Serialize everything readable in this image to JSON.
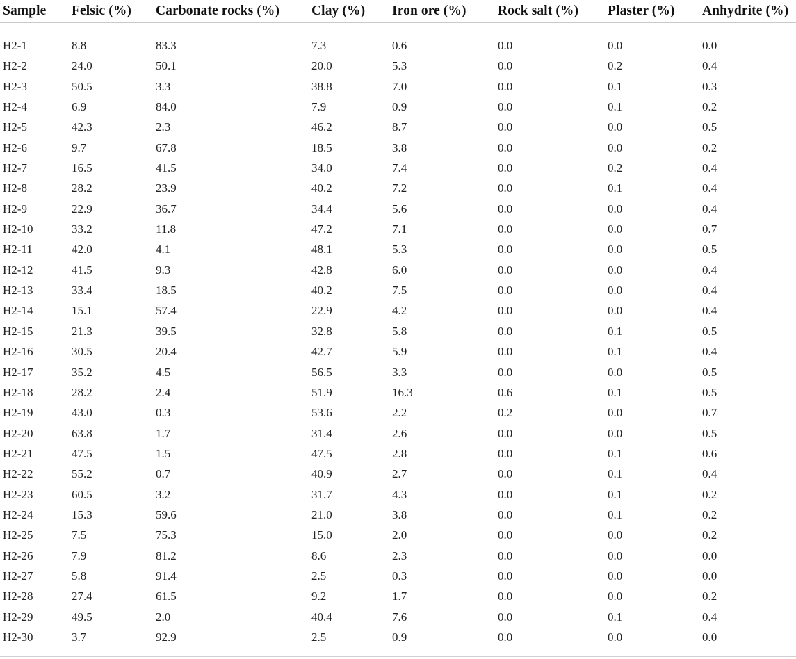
{
  "table": {
    "caption": "",
    "columns": [
      {
        "key": "sample",
        "label": "Sample"
      },
      {
        "key": "felsic",
        "label": "Felsic (%)"
      },
      {
        "key": "carbonate",
        "label": "Carbonate rocks (%)"
      },
      {
        "key": "clay",
        "label": "Clay (%)"
      },
      {
        "key": "iron_ore",
        "label": "Iron ore (%)"
      },
      {
        "key": "rock_salt",
        "label": "Rock salt (%)"
      },
      {
        "key": "plaster",
        "label": "Plaster (%)"
      },
      {
        "key": "anhydrite",
        "label": "Anhydrite (%)"
      }
    ],
    "rows": [
      {
        "sample": "H2-1",
        "felsic": "8.8",
        "carbonate": "83.3",
        "clay": "7.3",
        "iron_ore": "0.6",
        "rock_salt": "0.0",
        "plaster": "0.0",
        "anhydrite": "0.0"
      },
      {
        "sample": "H2-2",
        "felsic": "24.0",
        "carbonate": "50.1",
        "clay": "20.0",
        "iron_ore": "5.3",
        "rock_salt": "0.0",
        "plaster": "0.2",
        "anhydrite": "0.4"
      },
      {
        "sample": "H2-3",
        "felsic": "50.5",
        "carbonate": "3.3",
        "clay": "38.8",
        "iron_ore": "7.0",
        "rock_salt": "0.0",
        "plaster": "0.1",
        "anhydrite": "0.3"
      },
      {
        "sample": "H2-4",
        "felsic": "6.9",
        "carbonate": "84.0",
        "clay": "7.9",
        "iron_ore": "0.9",
        "rock_salt": "0.0",
        "plaster": "0.1",
        "anhydrite": "0.2"
      },
      {
        "sample": "H2-5",
        "felsic": "42.3",
        "carbonate": "2.3",
        "clay": "46.2",
        "iron_ore": "8.7",
        "rock_salt": "0.0",
        "plaster": "0.0",
        "anhydrite": "0.5"
      },
      {
        "sample": "H2-6",
        "felsic": "9.7",
        "carbonate": "67.8",
        "clay": "18.5",
        "iron_ore": "3.8",
        "rock_salt": "0.0",
        "plaster": "0.0",
        "anhydrite": "0.2"
      },
      {
        "sample": "H2-7",
        "felsic": "16.5",
        "carbonate": "41.5",
        "clay": "34.0",
        "iron_ore": "7.4",
        "rock_salt": "0.0",
        "plaster": "0.2",
        "anhydrite": "0.4"
      },
      {
        "sample": "H2-8",
        "felsic": "28.2",
        "carbonate": "23.9",
        "clay": "40.2",
        "iron_ore": "7.2",
        "rock_salt": "0.0",
        "plaster": "0.1",
        "anhydrite": "0.4"
      },
      {
        "sample": "H2-9",
        "felsic": "22.9",
        "carbonate": "36.7",
        "clay": "34.4",
        "iron_ore": "5.6",
        "rock_salt": "0.0",
        "plaster": "0.0",
        "anhydrite": "0.4"
      },
      {
        "sample": "H2-10",
        "felsic": "33.2",
        "carbonate": "11.8",
        "clay": "47.2",
        "iron_ore": "7.1",
        "rock_salt": "0.0",
        "plaster": "0.0",
        "anhydrite": "0.7"
      },
      {
        "sample": "H2-11",
        "felsic": "42.0",
        "carbonate": "4.1",
        "clay": "48.1",
        "iron_ore": "5.3",
        "rock_salt": "0.0",
        "plaster": "0.0",
        "anhydrite": "0.5"
      },
      {
        "sample": "H2-12",
        "felsic": "41.5",
        "carbonate": "9.3",
        "clay": "42.8",
        "iron_ore": "6.0",
        "rock_salt": "0.0",
        "plaster": "0.0",
        "anhydrite": "0.4"
      },
      {
        "sample": "H2-13",
        "felsic": "33.4",
        "carbonate": "18.5",
        "clay": "40.2",
        "iron_ore": "7.5",
        "rock_salt": "0.0",
        "plaster": "0.0",
        "anhydrite": "0.4"
      },
      {
        "sample": "H2-14",
        "felsic": "15.1",
        "carbonate": "57.4",
        "clay": "22.9",
        "iron_ore": "4.2",
        "rock_salt": "0.0",
        "plaster": "0.0",
        "anhydrite": "0.4"
      },
      {
        "sample": "H2-15",
        "felsic": "21.3",
        "carbonate": "39.5",
        "clay": "32.8",
        "iron_ore": "5.8",
        "rock_salt": "0.0",
        "plaster": "0.1",
        "anhydrite": "0.5"
      },
      {
        "sample": "H2-16",
        "felsic": "30.5",
        "carbonate": "20.4",
        "clay": "42.7",
        "iron_ore": "5.9",
        "rock_salt": "0.0",
        "plaster": "0.1",
        "anhydrite": "0.4"
      },
      {
        "sample": "H2-17",
        "felsic": "35.2",
        "carbonate": "4.5",
        "clay": "56.5",
        "iron_ore": "3.3",
        "rock_salt": "0.0",
        "plaster": "0.0",
        "anhydrite": "0.5"
      },
      {
        "sample": "H2-18",
        "felsic": "28.2",
        "carbonate": "2.4",
        "clay": "51.9",
        "iron_ore": "16.3",
        "rock_salt": "0.6",
        "plaster": "0.1",
        "anhydrite": "0.5"
      },
      {
        "sample": "H2-19",
        "felsic": "43.0",
        "carbonate": "0.3",
        "clay": "53.6",
        "iron_ore": "2.2",
        "rock_salt": "0.2",
        "plaster": "0.0",
        "anhydrite": "0.7"
      },
      {
        "sample": "H2-20",
        "felsic": "63.8",
        "carbonate": "1.7",
        "clay": "31.4",
        "iron_ore": "2.6",
        "rock_salt": "0.0",
        "plaster": "0.0",
        "anhydrite": "0.5"
      },
      {
        "sample": "H2-21",
        "felsic": "47.5",
        "carbonate": "1.5",
        "clay": "47.5",
        "iron_ore": "2.8",
        "rock_salt": "0.0",
        "plaster": "0.1",
        "anhydrite": "0.6"
      },
      {
        "sample": "H2-22",
        "felsic": "55.2",
        "carbonate": "0.7",
        "clay": "40.9",
        "iron_ore": "2.7",
        "rock_salt": "0.0",
        "plaster": "0.1",
        "anhydrite": "0.4"
      },
      {
        "sample": "H2-23",
        "felsic": "60.5",
        "carbonate": "3.2",
        "clay": "31.7",
        "iron_ore": "4.3",
        "rock_salt": "0.0",
        "plaster": "0.1",
        "anhydrite": "0.2"
      },
      {
        "sample": "H2-24",
        "felsic": "15.3",
        "carbonate": "59.6",
        "clay": "21.0",
        "iron_ore": "3.8",
        "rock_salt": "0.0",
        "plaster": "0.1",
        "anhydrite": "0.2"
      },
      {
        "sample": "H2-25",
        "felsic": "7.5",
        "carbonate": "75.3",
        "clay": "15.0",
        "iron_ore": "2.0",
        "rock_salt": "0.0",
        "plaster": "0.0",
        "anhydrite": "0.2"
      },
      {
        "sample": "H2-26",
        "felsic": "7.9",
        "carbonate": "81.2",
        "clay": "8.6",
        "iron_ore": "2.3",
        "rock_salt": "0.0",
        "plaster": "0.0",
        "anhydrite": "0.0"
      },
      {
        "sample": "H2-27",
        "felsic": "5.8",
        "carbonate": "91.4",
        "clay": "2.5",
        "iron_ore": "0.3",
        "rock_salt": "0.0",
        "plaster": "0.0",
        "anhydrite": "0.0"
      },
      {
        "sample": "H2-28",
        "felsic": "27.4",
        "carbonate": "61.5",
        "clay": "9.2",
        "iron_ore": "1.7",
        "rock_salt": "0.0",
        "plaster": "0.0",
        "anhydrite": "0.2"
      },
      {
        "sample": "H2-29",
        "felsic": "49.5",
        "carbonate": "2.0",
        "clay": "40.4",
        "iron_ore": "7.6",
        "rock_salt": "0.0",
        "plaster": "0.1",
        "anhydrite": "0.4"
      },
      {
        "sample": "H2-30",
        "felsic": "3.7",
        "carbonate": "92.9",
        "clay": "2.5",
        "iron_ore": "0.9",
        "rock_salt": "0.0",
        "plaster": "0.0",
        "anhydrite": "0.0"
      }
    ]
  },
  "style": {
    "header_rule_color": "#c9c9c9",
    "bottom_rule_color": "#cfcfcf",
    "header_text_color": "#121212",
    "body_text_color": "#222222",
    "background_color": "#ffffff"
  }
}
